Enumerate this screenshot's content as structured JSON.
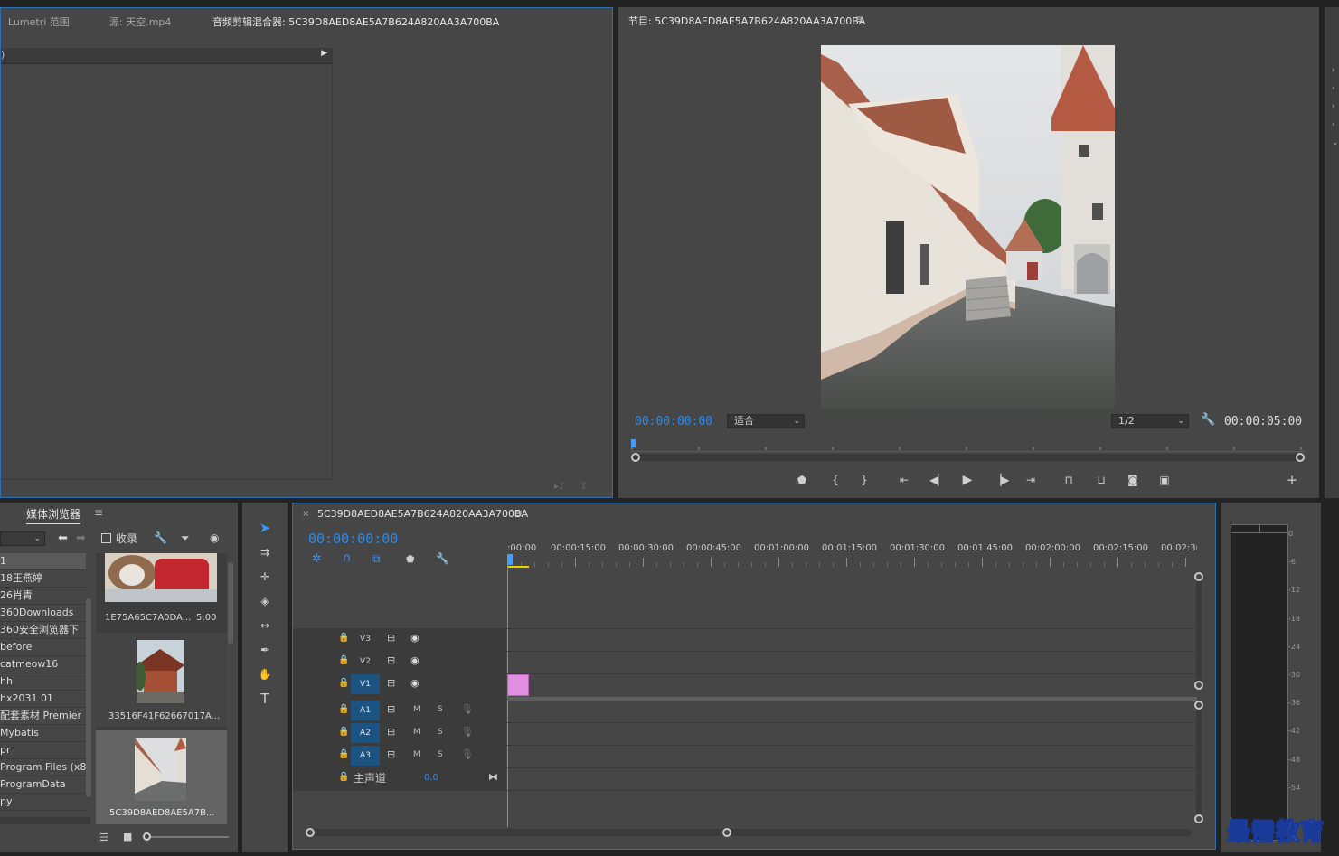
{
  "top_left_panel": {
    "tabs": [
      "Lumetri 范围",
      "源: 天空.mp4",
      "音频剪辑混合器: 5C39D8AED8AE5A7B624A820AA3A700BA"
    ],
    "header_left": ")"
  },
  "program_monitor": {
    "title": "节目: 5C39D8AED8AE5A7B624A820AA3A700BA",
    "current_time": "00:00:00:00",
    "fit_value": "适合",
    "resolution": "1/2",
    "duration": "00:00:05:00"
  },
  "media_browser": {
    "tab_label": "媒体浏览器",
    "favorites_label": "收录",
    "folders": [
      "1",
      "18王燕婷",
      "26肖青",
      "360Downloads",
      "360安全浏览器下",
      "before",
      "catmeow16",
      "hh",
      "hx2031 01",
      "配套素材 Premier",
      "Mybatis",
      "pr",
      "Program Files (x86",
      "ProgramData",
      "py"
    ],
    "clips": [
      {
        "name": "1E75A65C7A0DA...",
        "duration": "5:00"
      },
      {
        "name": "33516F41F62667017A...",
        "duration": ""
      },
      {
        "name": "5C39D8AED8AE5A7B...",
        "duration": ""
      }
    ]
  },
  "timeline": {
    "sequence_name": "5C39D8AED8AE5A7B624A820AA3A700BA",
    "current_time": "00:00:00:00",
    "ruler_labels": [
      ":00:00",
      "00:00:15:00",
      "00:00:30:00",
      "00:00:45:00",
      "00:01:00:00",
      "00:01:15:00",
      "00:01:30:00",
      "00:01:45:00",
      "00:02:00:00",
      "00:02:15:00",
      "00:02:3("
    ],
    "video_tracks": [
      "V3",
      "V2",
      "V1"
    ],
    "audio_tracks": [
      "A1",
      "A2",
      "A3"
    ],
    "mute_label": "M",
    "solo_label": "S",
    "master_label": "主声道",
    "master_value": "0.0"
  },
  "audio_meter": {
    "labels": [
      "0",
      "-6",
      "-12",
      "-18",
      "-24",
      "-30",
      "-36",
      "-42",
      "-48",
      "-54"
    ]
  },
  "watermark": "最需教育",
  "colors": {
    "accent": "#2d8ceb",
    "selected_track": "#1d5380",
    "clip": "#e08ee0",
    "panel": "#464646",
    "background": "#232323"
  }
}
